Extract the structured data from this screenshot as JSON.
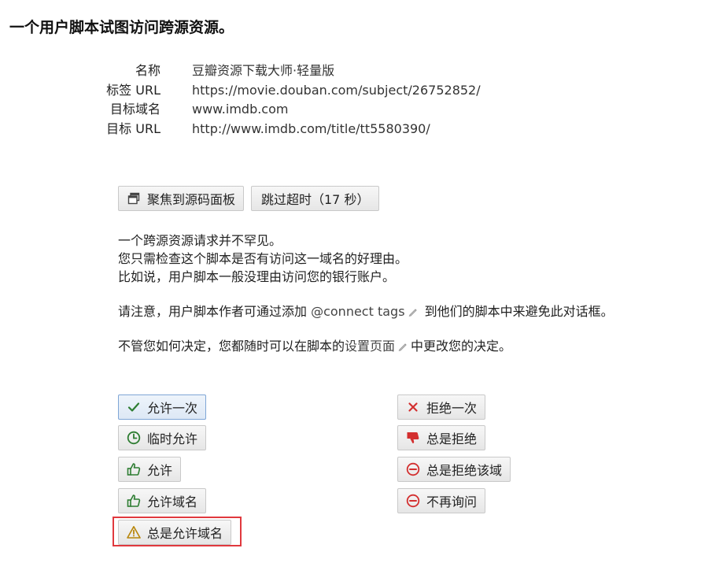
{
  "dialog": {
    "title": "一个用户脚本试图访问跨源资源。"
  },
  "info": [
    {
      "label": "名称",
      "value": "豆瓣资源下载大师·轻量版"
    },
    {
      "label": "标签 URL",
      "value": "https://movie.douban.com/subject/26752852/"
    },
    {
      "label": "目标域名",
      "value": "www.imdb.com"
    },
    {
      "label": "目标 URL",
      "value": "http://www.imdb.com/title/tt5580390/"
    }
  ],
  "toolbar": {
    "focus_label": "聚焦到源码面板",
    "skip_label": "跳过超时（17 秒）"
  },
  "message": {
    "line1": "一个跨源资源请求并不罕见。",
    "line2": "您只需检查这个脚本是否有访问这一域名的好理由。",
    "line3": "比如说，用户脚本一般没理由访问您的银行账户。",
    "note_prefix": "请注意，用户脚本作者可通过添加 ",
    "note_link": "@connect tags",
    "note_suffix": " 到他们的脚本中来避免此对话框。",
    "settings_prefix": "不管您如何决定，您都随时可以在脚本的",
    "settings_link": "设置页面",
    "settings_suffix": "中更改您的决定。"
  },
  "allow_buttons": {
    "allow_once": "允许一次",
    "allow_temp": "临时允许",
    "allow": "允许",
    "allow_domain": "允许域名",
    "always_allow_domain": "总是允许域名"
  },
  "deny_buttons": {
    "deny_once": "拒绝一次",
    "always_deny": "总是拒绝",
    "always_deny_domain": "总是拒绝该域",
    "never_ask": "不再询问"
  },
  "colors": {
    "allow_green": "#2e7d32",
    "deny_red": "#d32f2f",
    "warning_amber": "#d4a017",
    "highlight_red": "#e0393e"
  }
}
